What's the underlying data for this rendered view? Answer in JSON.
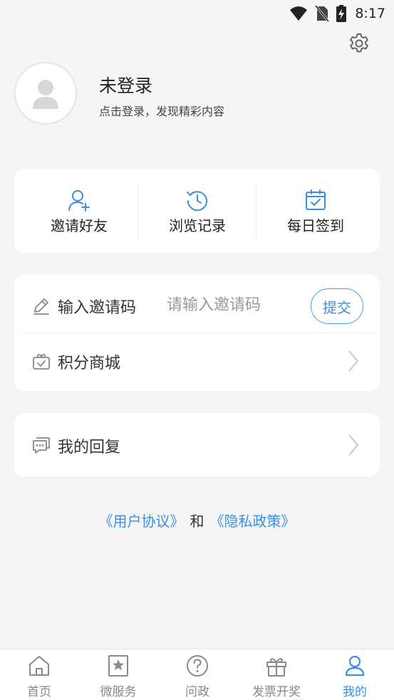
{
  "status_bar": {
    "time": "8:17"
  },
  "profile": {
    "name": "未登录",
    "subtitle": "点击登录，发现精彩内容"
  },
  "quick_actions": [
    {
      "label": "邀请好友",
      "icon": "add-user-icon"
    },
    {
      "label": "浏览记录",
      "icon": "history-icon"
    },
    {
      "label": "每日签到",
      "icon": "calendar-check-icon"
    }
  ],
  "invite": {
    "label": "输入邀请码",
    "placeholder": "请输入邀请码",
    "submit": "提交"
  },
  "menu": {
    "points_mall": "积分商城",
    "my_replies": "我的回复"
  },
  "agreement": {
    "user_agreement": "《用户协议》",
    "and": "和",
    "privacy_policy": "《隐私政策》"
  },
  "tabs": [
    {
      "label": "首页",
      "icon": "home-icon",
      "active": false
    },
    {
      "label": "微服务",
      "icon": "star-bookmark-icon",
      "active": false
    },
    {
      "label": "问政",
      "icon": "question-icon",
      "active": false
    },
    {
      "label": "发票开奖",
      "icon": "gift-box-icon",
      "active": false
    },
    {
      "label": "我的",
      "icon": "user-icon",
      "active": true
    }
  ],
  "colors": {
    "accent": "#3a8fe0",
    "background": "#f5f5f5",
    "card": "#ffffff"
  }
}
